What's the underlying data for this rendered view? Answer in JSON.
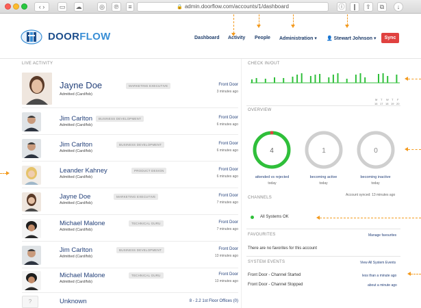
{
  "browser": {
    "url": "admin.doorflow.com/accounts/1/dashboard"
  },
  "brand": {
    "part1": "DOOR",
    "part2": "FLOW"
  },
  "nav": {
    "dashboard": "Dashboard",
    "activity": "Activity",
    "people": "People",
    "administration": "Administration",
    "user": "Stewart Johnson",
    "sync": "Sync"
  },
  "live_activity": {
    "label": "LIVE ACTIVITY",
    "items": [
      {
        "name": "Jayne Doe",
        "tag": "MARKETING EXECUTIVE",
        "status": "Admitted (Card/fob)",
        "door": "Front Door",
        "ago": "3 minutes ago"
      },
      {
        "name": "Jim Carlton",
        "tag": "BUSINESS DEVELOPMENT",
        "status": "Admitted (Card/fob)",
        "door": "Front Door",
        "ago": "6 minutes ago"
      },
      {
        "name": "Jim Carlton",
        "tag": "BUSINESS DEVELOPMENT",
        "status": "Admitted (Card/fob)",
        "door": "Front Door",
        "ago": "6 minutes ago"
      },
      {
        "name": "Leander Kahney",
        "tag": "PRODUCT DESIGN",
        "status": "Admitted (Card/fob)",
        "door": "Front Door",
        "ago": "6 minutes ago"
      },
      {
        "name": "Jayne Doe",
        "tag": "MARKETING EXECUTIVE",
        "status": "Admitted (Card/fob)",
        "door": "Front Door",
        "ago": "7 minutes ago"
      },
      {
        "name": "Michael Malone",
        "tag": "TECHNICAL GURU",
        "status": "Admitted (Card/fob)",
        "door": "Front Door",
        "ago": "7 minutes ago"
      },
      {
        "name": "Jim Carlton",
        "tag": "BUSINESS DEVELOPMENT",
        "status": "Admitted (Card/fob)",
        "door": "Front Door",
        "ago": "13 minutes ago"
      },
      {
        "name": "Michael Malone",
        "tag": "TECHNICAL GURU",
        "status": "Admitted (Card/fob)",
        "door": "Front Door",
        "ago": "13 minutes ago"
      },
      {
        "name": "Unknown",
        "tag": "",
        "status": "",
        "door": "8 - 2.2 1st Floor Offices (0)",
        "ago": ""
      }
    ]
  },
  "check_inout": {
    "label": "CHECK IN/OUT",
    "weekdays": [
      "M",
      "T",
      "W",
      "T",
      "F"
    ],
    "days": [
      "16",
      "17",
      "18",
      "19",
      "20"
    ],
    "bars": [
      5,
      7,
      0,
      6,
      0,
      8,
      0,
      7,
      0,
      9,
      12,
      14,
      0,
      10,
      12,
      13,
      0,
      8,
      12,
      14,
      0,
      6,
      0,
      12,
      14,
      8,
      0,
      0,
      13,
      14,
      10,
      0,
      12
    ]
  },
  "overview": {
    "label": "OVERVIEW",
    "rings": [
      {
        "value": "4",
        "label": "attended vs rejected",
        "sub": "today",
        "color": "#2fbf3a"
      },
      {
        "value": "1",
        "label": "becoming active",
        "sub": "today",
        "color": "#cfcfcf"
      },
      {
        "value": "0",
        "label": "becoming inactive",
        "sub": "today",
        "color": "#cfcfcf"
      }
    ],
    "synced": "Account synced: 13 minutes ago"
  },
  "channels": {
    "label": "CHANNELS",
    "status": "All Systems OK",
    "status_color": "#2fbf3a"
  },
  "favourites": {
    "label": "FAVOURITES",
    "manage": "Manage favourites",
    "empty": "There are no favorites for this account"
  },
  "system_events": {
    "label": "SYSTEM EVENTS",
    "view_all": "View All System Events",
    "events": [
      {
        "text": "Front Door - Channel Started",
        "ago": "less than a minute ago"
      },
      {
        "text": "Front Door - Channel Stopped",
        "ago": "about a minute ago"
      }
    ]
  },
  "colors": {
    "accent": "#f39a1e",
    "brand_dark": "#1d4e8c",
    "brand_light": "#3a8fd6",
    "danger": "#e0413f"
  }
}
